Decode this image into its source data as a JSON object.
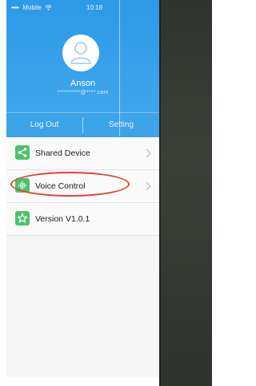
{
  "status_bar": {
    "signal": "•••••",
    "carrier": "Mobile",
    "time": "10:18"
  },
  "profile": {
    "name": "Anson",
    "email": "**********@****.com"
  },
  "actions": {
    "logout_label": "Log Out",
    "setting_label": "Setting"
  },
  "menu": {
    "items": [
      {
        "label": "Shared Device",
        "icon": "share-icon"
      },
      {
        "label": "Voice Control",
        "icon": "voice-icon",
        "highlighted": true
      },
      {
        "label": "Version V1.0.1",
        "icon": "star-icon"
      }
    ]
  },
  "colors": {
    "header_blue": "#2d9ae6",
    "icon_green": "#4cc36a",
    "highlight_red": "#e2452e"
  }
}
